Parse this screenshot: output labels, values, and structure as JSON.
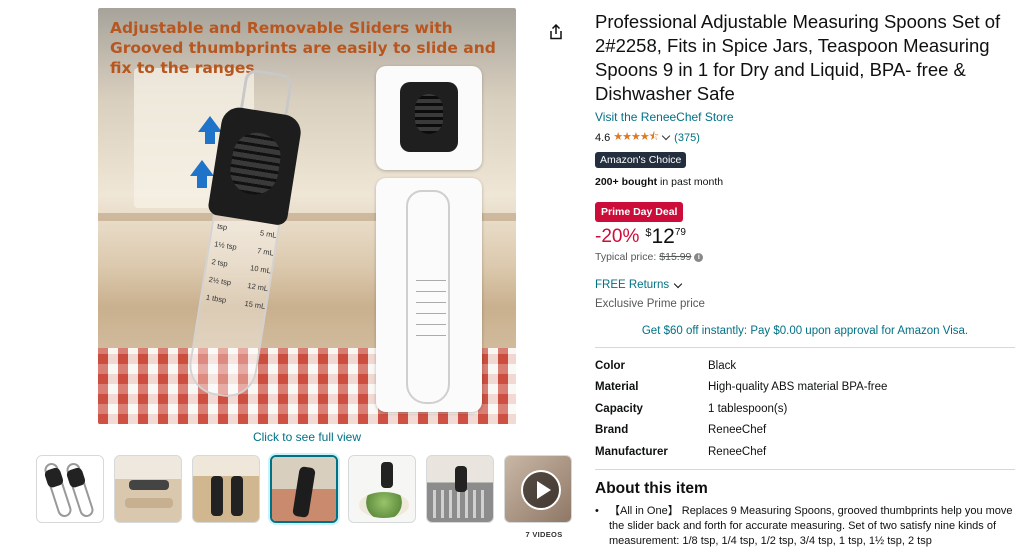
{
  "gallery": {
    "headline": "Adjustable and Removable Sliders with Grooved thumbprints are easily to slide and fix to the ranges",
    "spoon_marks": [
      {
        "left": "tsp",
        "right": "5 mL"
      },
      {
        "left": "1½ tsp",
        "right": "7 mL"
      },
      {
        "left": "2 tsp",
        "right": "10 mL"
      },
      {
        "left": "2½ tsp",
        "right": "12 mL"
      },
      {
        "left": "1 tbsp",
        "right": "15 mL"
      }
    ],
    "click_to_see": "Click to see full view",
    "videos_label": "7 VIDEOS",
    "thumbnails": [
      {
        "name": "thumb-1"
      },
      {
        "name": "thumb-2"
      },
      {
        "name": "thumb-3"
      },
      {
        "name": "thumb-4",
        "selected": true
      },
      {
        "name": "thumb-5"
      },
      {
        "name": "thumb-6"
      },
      {
        "name": "thumb-7-video"
      }
    ]
  },
  "product": {
    "title": "Professional Adjustable Measuring Spoons Set of 2#2258, Fits in Spice Jars, Teaspoon Measuring Spoons 9 in 1 for Dry and Liquid, BPA- free & Dishwasher Safe",
    "store_link": "Visit the ReneeChef Store",
    "rating_value": "4.6",
    "stars": "★★★★⯪",
    "rating_count": "(375)",
    "badge": "Amazon's Choice",
    "bought_bold": "200+ bought",
    "bought_rest": " in past month",
    "deal_badge": "Prime Day Deal",
    "discount": "-20%",
    "price_symbol": "$",
    "price_whole": "12",
    "price_fraction": "79",
    "typical_label": "Typical price:",
    "typical_price": "$15.99",
    "returns": "FREE Returns",
    "exclusive": "Exclusive Prime price",
    "visa_offer": "Get $60 off instantly: Pay $0.00 upon approval for Amazon Visa."
  },
  "specs": [
    {
      "key": "Color",
      "value": "Black"
    },
    {
      "key": "Material",
      "value": "High-quality ABS material BPA-free"
    },
    {
      "key": "Capacity",
      "value": "1 tablespoon(s)"
    },
    {
      "key": "Brand",
      "value": "ReneeChef"
    },
    {
      "key": "Manufacturer",
      "value": "ReneeChef"
    }
  ],
  "about": {
    "heading": "About this item",
    "bullets": [
      "【All in One】 Replaces 9 Measuring Spoons, grooved thumbprints help you move the slider back and forth for accurate measuring. Set of two satisfy nine kinds of measurement: 1/8 tsp, 1/4 tsp, 1/2 tsp, 3/4 tsp, 1 tsp, 1½ tsp, 2 tsp"
    ]
  },
  "colors": {
    "link": "#007185",
    "deal": "#cc0c39",
    "choice_bg": "#232f3e",
    "star": "#de7921"
  }
}
